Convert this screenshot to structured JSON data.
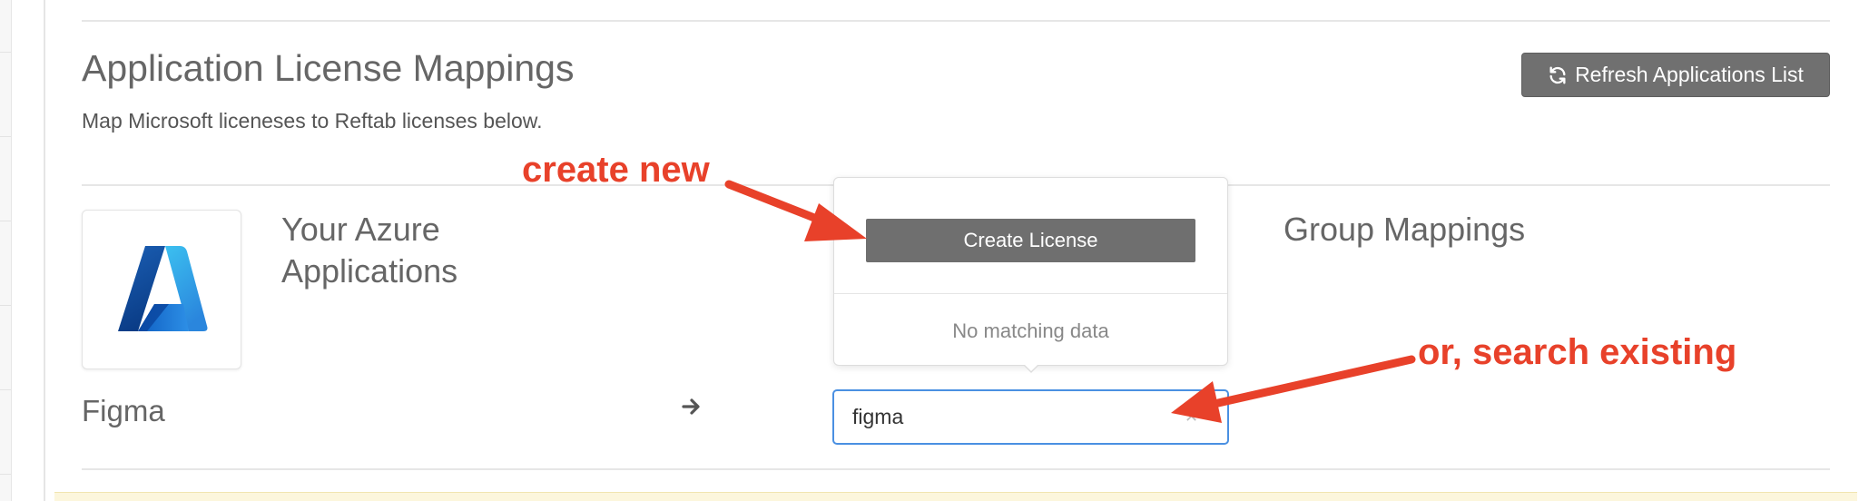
{
  "page": {
    "title": "Application License Mappings",
    "subtitle": "Map Microsoft liceneses to Reftab licenses below.",
    "refresh_button": {
      "label": "Refresh Applications List",
      "icon": "refresh-icon"
    }
  },
  "columns": {
    "azure_apps_heading": "Your Azure Applications",
    "group_mappings_heading": "Group Mappings"
  },
  "row": {
    "app_name": "Figma",
    "app_logo_icon": "azure-logo-icon",
    "arrow_icon": "arrow-right-icon"
  },
  "license_select": {
    "value": "figma",
    "clear_icon": "clear-icon",
    "dropdown": {
      "create_button_label": "Create License",
      "empty_text": "No matching data"
    }
  },
  "annotations": {
    "create_new": "create new",
    "search_existing": "or, search existing",
    "color": "#e8412a"
  },
  "colors": {
    "primary_button": "#707070",
    "focus_border": "#4a90e2",
    "heading_text": "#666666"
  }
}
